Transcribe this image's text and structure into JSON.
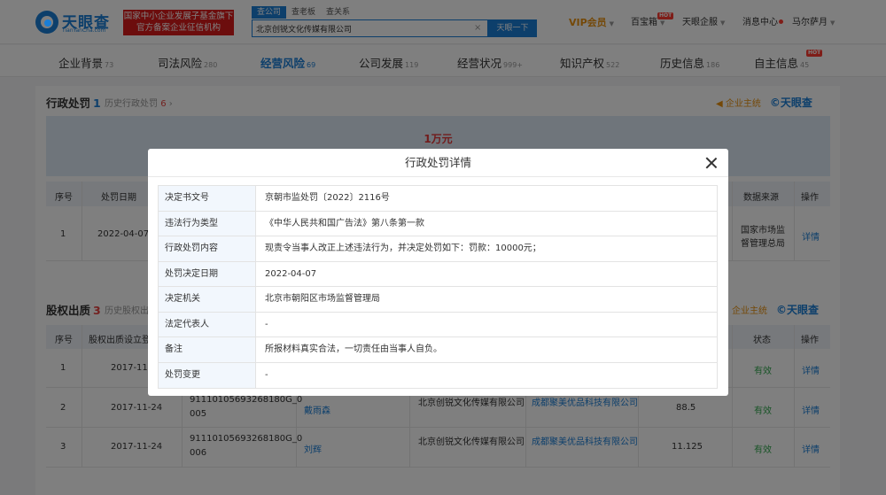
{
  "header": {
    "logo_title": "天眼查",
    "logo_sub": "TianYanCha.com",
    "banner_line1": "国家中小企业发展子基金旗下",
    "banner_line2": "官方备案企业征信机构",
    "search_tabs": [
      "查公司",
      "查老板",
      "查关系"
    ],
    "search_value": "北京创锐文化传媒有限公司",
    "search_clear": "×",
    "search_button": "天眼一下",
    "vip": "VIP会员",
    "baibaoxiang": "百宝箱",
    "qifu": "天眼企服",
    "messages": "消息中心",
    "user": "马尔萨月",
    "hot": "HOT"
  },
  "tabs": [
    {
      "label": "企业背景",
      "count": "73"
    },
    {
      "label": "司法风险",
      "count": "280"
    },
    {
      "label": "经营风险",
      "count": "69"
    },
    {
      "label": "公司发展",
      "count": "119"
    },
    {
      "label": "经营状况",
      "count": "999+"
    },
    {
      "label": "知识产权",
      "count": "522"
    },
    {
      "label": "历史信息",
      "count": "186"
    },
    {
      "label": "自主信息",
      "count": "45"
    }
  ],
  "penalty_section": {
    "title": "行政处罚",
    "count": "1",
    "history_label": "历史行政处罚",
    "history_count": "6",
    "history_arrow": "›",
    "brand_service": "企业主统",
    "brand_name": "©天眼查",
    "amount": "1万元",
    "columns": [
      "序号",
      "处罚日期",
      "数据来源",
      "操作"
    ],
    "row": {
      "index": "1",
      "date": "2022-04-07",
      "source_line1": "国家市场监",
      "source_line2": "督管理总局",
      "action": "详情"
    }
  },
  "equity_section": {
    "title": "股权出质",
    "count": "3",
    "history_label": "历史股权出",
    "brand_service": "企业主统",
    "brand_name": "©天眼查",
    "columns": [
      "序号",
      "股权出质设立登",
      "状态",
      "操作"
    ],
    "rows": [
      {
        "index": "1",
        "date": "2017-11-2",
        "reg_line1": "",
        "reg_line2": "",
        "pledgor": "",
        "company": "",
        "pledgee": "",
        "amount": "",
        "status": "有效",
        "action": "详情"
      },
      {
        "index": "2",
        "date": "2017-11-24",
        "reg_line1": "91110105693268180G_0",
        "reg_line2": "005",
        "pledgor": "戴雨森",
        "company": "北京创锐文化传媒有限公司",
        "pledgee": "成都聚美优品科技有限公司",
        "amount": "88.5",
        "status": "有效",
        "action": "详情"
      },
      {
        "index": "3",
        "date": "2017-11-24",
        "reg_line1": "91110105693268180G_0",
        "reg_line2": "006",
        "pledgor": "刘辉",
        "company": "北京创锐文化传媒有限公司",
        "pledgee": "成都聚美优品科技有限公司",
        "amount": "11.125",
        "status": "有效",
        "action": "详情"
      }
    ]
  },
  "modal": {
    "title": "行政处罚详情",
    "rows": [
      {
        "key": "决定书文号",
        "value": "京朝市监处罚〔2022〕2116号"
      },
      {
        "key": "违法行为类型",
        "value": "《中华人民共和国广告法》第八条第一款"
      },
      {
        "key": "行政处罚内容",
        "value": "现责令当事人改正上述违法行为，并决定处罚如下：罚款：10000元；"
      },
      {
        "key": "处罚决定日期",
        "value": "2022-04-07"
      },
      {
        "key": "决定机关",
        "value": "北京市朝阳区市场监督管理局"
      },
      {
        "key": "法定代表人",
        "value": "-"
      },
      {
        "key": "备注",
        "value": "所报材料真实合法，一切责任由当事人自负。"
      },
      {
        "key": "处罚变更",
        "value": "-"
      }
    ]
  },
  "colors": {
    "brand_blue": "#1a7ed6",
    "banner_red": "#d91a1a",
    "vip_orange": "#e8910f",
    "status_green": "#31a84f",
    "hot_red": "#ff3b30"
  }
}
